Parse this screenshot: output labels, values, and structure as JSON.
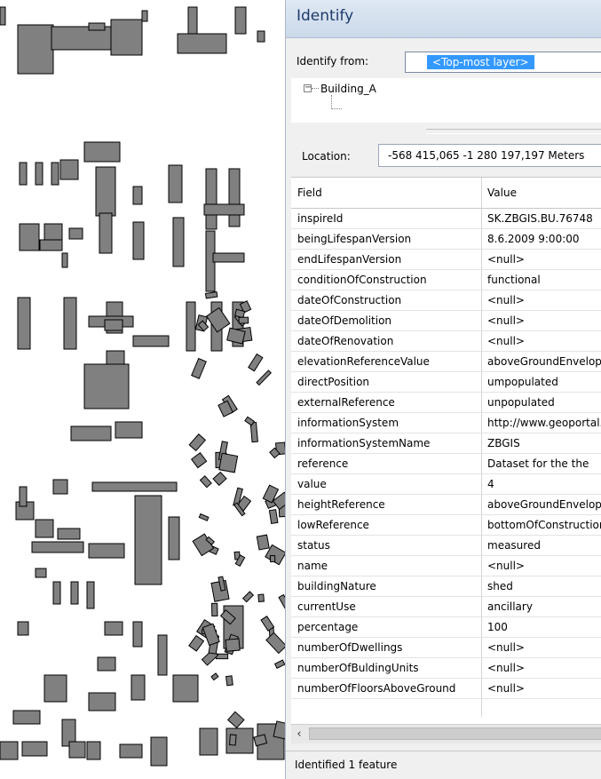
{
  "map": {
    "fill_color": "#808080",
    "stroke_color": "#000000"
  },
  "identify": {
    "title": "Identify",
    "from_label": "Identify from:",
    "from_value": "<Top-most layer>",
    "tree": {
      "layer_name": "Building_A",
      "collapse_glyph": "−"
    },
    "location_label": "Location:",
    "location_value": "-568 415,065  -1 280 197,197 Meters",
    "columns": {
      "field": "Field",
      "value": "Value"
    },
    "rows": [
      {
        "field": "inspireId",
        "value": "SK.ZBGIS.BU.76748"
      },
      {
        "field": "beingLifespanVersion",
        "value": "8.6.2009 9:00:00"
      },
      {
        "field": "endLifespanVersion",
        "value": "<null>"
      },
      {
        "field": "conditionOfConstruction",
        "value": "functional"
      },
      {
        "field": "dateOfConstruction",
        "value": "<null>"
      },
      {
        "field": "dateOfDemolition",
        "value": "<null>"
      },
      {
        "field": "dateOfRenovation",
        "value": "<null>"
      },
      {
        "field": "elevationReferenceValue",
        "value": "aboveGroundEnvelope"
      },
      {
        "field": "directPosition",
        "value": "umpopulated"
      },
      {
        "field": "externalReference",
        "value": "unpopulated"
      },
      {
        "field": "informationSystem",
        "value": "http://www.geoportal.sk"
      },
      {
        "field": "informationSystemName",
        "value": "ZBGIS"
      },
      {
        "field": "reference",
        "value": "Dataset for the the"
      },
      {
        "field": "value",
        "value": "4"
      },
      {
        "field": "heightReference",
        "value": "aboveGroundEnvelope"
      },
      {
        "field": "lowReference",
        "value": "bottomOfConstruction"
      },
      {
        "field": "status",
        "value": "measured"
      },
      {
        "field": "name",
        "value": "<null>"
      },
      {
        "field": "buildingNature",
        "value": "shed"
      },
      {
        "field": "currentUse",
        "value": "ancillary"
      },
      {
        "field": "percentage",
        "value": "100"
      },
      {
        "field": "numberOfDwellings",
        "value": "<null>"
      },
      {
        "field": "numberOfBuldingUnits",
        "value": "<null>"
      },
      {
        "field": "numberOfFloorsAboveGround",
        "value": "<null>"
      }
    ],
    "scroll_left_glyph": "‹",
    "status": "Identified 1 feature"
  }
}
